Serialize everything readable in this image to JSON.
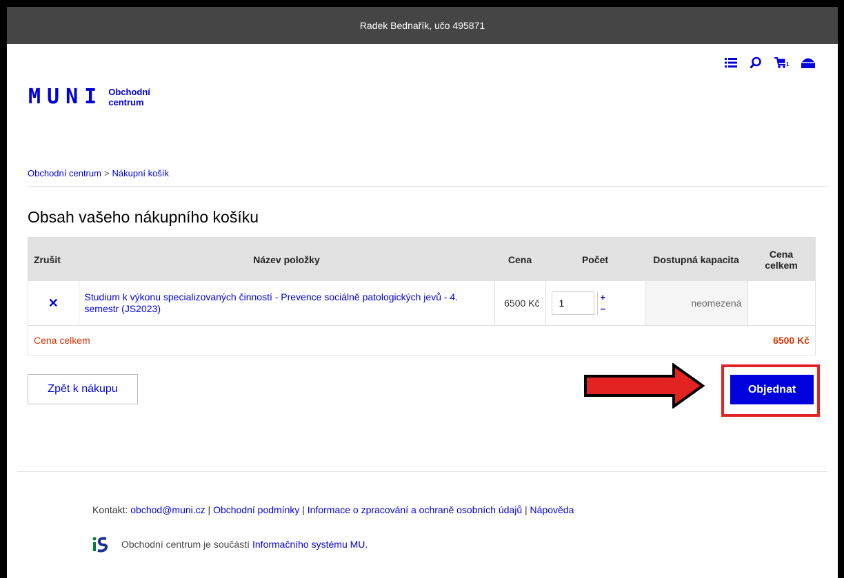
{
  "topbar": {
    "user": "Radek Bednařík, učo 495871"
  },
  "header": {
    "logo_mark": "MUNI",
    "logo_line1": "Obchodní",
    "logo_line2": "centrum",
    "cart_count": "1"
  },
  "breadcrumb": {
    "home": "Obchodní centrum",
    "sep": ">",
    "current": "Nákupní košík"
  },
  "page_title": "Obsah vašeho nákupního košíku",
  "table": {
    "headers": {
      "remove": "Zrušit",
      "name": "Název položky",
      "price": "Cena",
      "qty": "Počet",
      "capacity": "Dostupná kapacita",
      "total": "Cena celkem"
    },
    "rows": [
      {
        "remove": "✕",
        "name": "Studium k výkonu specializovaných činností - Prevence sociálně patologických jevů - 4. semestr (JS2023)",
        "price": "6500 Kč",
        "qty": "1",
        "capacity": "neomezená",
        "total": ""
      }
    ],
    "sum_label": "Cena celkem",
    "sum_value": "6500 Kč"
  },
  "buttons": {
    "back": "Zpět k nákupu",
    "order": "Objednat"
  },
  "footer": {
    "contact_label": "Kontakt:",
    "email": "obchod@muni.cz",
    "sep": "|",
    "terms": "Obchodní podmínky",
    "privacy": "Informace o zpracování a ochraně osobních údajů",
    "help": "Nápověda",
    "is_text": "Obchodní centrum je součástí",
    "is_link": "Informačního systému MU."
  },
  "colors": {
    "brand_blue": "#0000dc",
    "topbar": "#454545",
    "accent_red": "#d53000",
    "annotation_red": "#e32222"
  },
  "icons": [
    "list-icon",
    "search-icon",
    "cart-icon",
    "bag-icon",
    "close-icon",
    "plus-icon",
    "minus-icon",
    "is-logo-icon",
    "arrow-annotation"
  ]
}
